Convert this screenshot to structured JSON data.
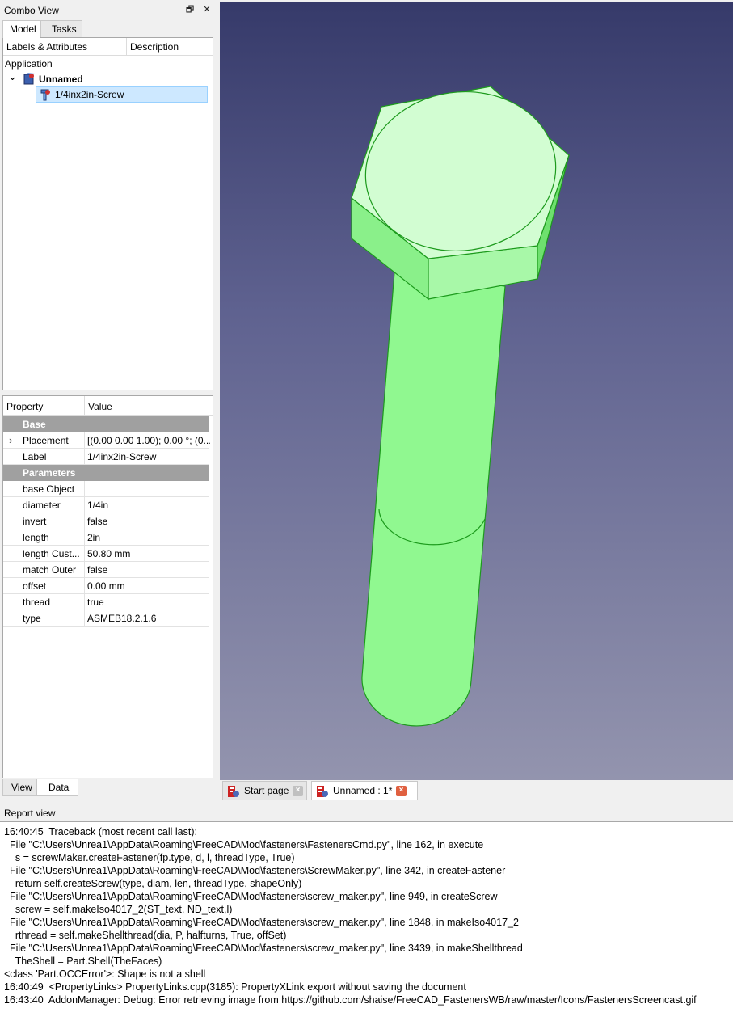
{
  "combo": {
    "title": "Combo View",
    "float_glyph": "🗗",
    "close_glyph": "✕",
    "tabs": [
      {
        "label": "Model"
      },
      {
        "label": "Tasks"
      }
    ]
  },
  "tree": {
    "col_labels": "Labels & Attributes",
    "col_description": "Description",
    "application": "Application",
    "expand_glyph": "⌄",
    "document": "Unnamed",
    "object": "1/4inx2in-Screw"
  },
  "properties": {
    "col_property": "Property",
    "col_value": "Value",
    "expand_glyph": "›",
    "groups": [
      {
        "name": "Base",
        "rows": [
          {
            "name": "Placement",
            "value": "[(0.00 0.00 1.00); 0.00 °; (0...."
          },
          {
            "name": "Label",
            "value": "1/4inx2in-Screw"
          }
        ]
      },
      {
        "name": "Parameters",
        "rows": [
          {
            "name": "base Object",
            "value": ""
          },
          {
            "name": "diameter",
            "value": "1/4in"
          },
          {
            "name": "invert",
            "value": "false"
          },
          {
            "name": "length",
            "value": "2in"
          },
          {
            "name": "length Cust...",
            "value": "50.80 mm"
          },
          {
            "name": "match Outer",
            "value": "false"
          },
          {
            "name": "offset",
            "value": "0.00 mm"
          },
          {
            "name": "thread",
            "value": "true"
          },
          {
            "name": "type",
            "value": "ASMEB18.2.1.6"
          }
        ]
      }
    ],
    "bottom_tabs": [
      {
        "label": "View"
      },
      {
        "label": "Data"
      }
    ]
  },
  "doc_tabs": [
    {
      "label": "Start page"
    },
    {
      "label": "Unnamed : 1*"
    }
  ],
  "colors": {
    "close_inactive": "#c0c0c0",
    "close_active": "#e06040",
    "model_green": "#90f890",
    "model_light": "#d2fdd2",
    "model_edge": "#1c9a1c"
  },
  "report": {
    "title": "Report view",
    "lines": [
      "16:40:45  Traceback (most recent call last):",
      "  File \"C:\\Users\\Unrea1\\AppData\\Roaming\\FreeCAD\\Mod\\fasteners\\FastenersCmd.py\", line 162, in execute",
      "    s = screwMaker.createFastener(fp.type, d, l, threadType, True)",
      "  File \"C:\\Users\\Unrea1\\AppData\\Roaming\\FreeCAD\\Mod\\fasteners\\ScrewMaker.py\", line 342, in createFastener",
      "    return self.createScrew(type, diam, len, threadType, shapeOnly)",
      "  File \"C:\\Users\\Unrea1\\AppData\\Roaming\\FreeCAD\\Mod\\fasteners\\screw_maker.py\", line 949, in createScrew",
      "    screw = self.makeIso4017_2(ST_text, ND_text,l)",
      "  File \"C:\\Users\\Unrea1\\AppData\\Roaming\\FreeCAD\\Mod\\fasteners\\screw_maker.py\", line 1848, in makeIso4017_2",
      "    rthread = self.makeShellthread(dia, P, halfturns, True, offSet)",
      "  File \"C:\\Users\\Unrea1\\AppData\\Roaming\\FreeCAD\\Mod\\fasteners\\screw_maker.py\", line 3439, in makeShellthread",
      "    TheShell = Part.Shell(TheFaces)",
      "<class 'Part.OCCError'>: Shape is not a shell",
      "16:40:49  <PropertyLinks> PropertyLinks.cpp(3185): PropertyXLink export without saving the document",
      "16:43:40  AddonManager: Debug: Error retrieving image from https://github.com/shaise/FreeCAD_FastenersWB/raw/master/Icons/FastenersScreencast.gif"
    ]
  }
}
